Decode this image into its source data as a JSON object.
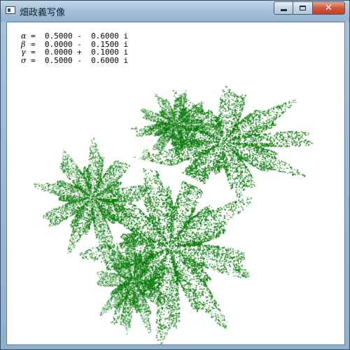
{
  "window": {
    "title": "畑政義写像",
    "buttons": {
      "minimize": "minimize",
      "maximize": "maximize",
      "close": "✕"
    }
  },
  "params": [
    {
      "symbol": "α",
      "text": "=  0.5000 -  0.6000 i"
    },
    {
      "symbol": "β",
      "text": "=  0.0000 -  0.1500 i"
    },
    {
      "symbol": "γ",
      "text": "=  0.0000 +  0.1000 i"
    },
    {
      "symbol": "σ",
      "text": "=  0.5000 -  0.6000 i"
    }
  ],
  "colors": {
    "fractal": "#0b7a0b",
    "background": "#ffffff"
  },
  "icons": [
    "app-icon",
    "minimize-icon",
    "maximize-icon",
    "close-icon"
  ]
}
